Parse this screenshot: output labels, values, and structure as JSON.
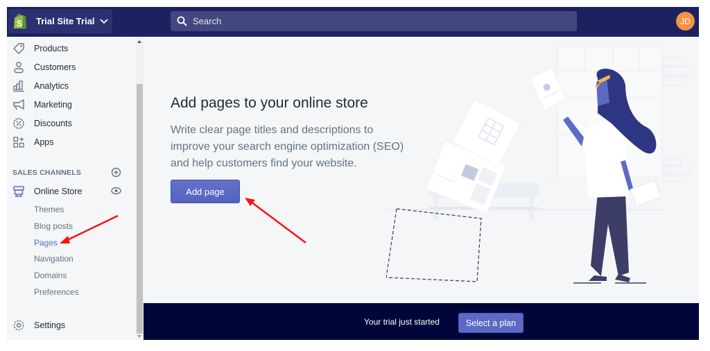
{
  "topbar": {
    "store_name": "Trial Site Trial",
    "search_placeholder": "Search",
    "avatar_initials": "JD",
    "colors": {
      "bar": "#1c2260",
      "search": "#43467f",
      "avatar": "#f49342",
      "logo": "#95bf47"
    }
  },
  "sidebar": {
    "items": [
      {
        "label": "Products",
        "icon": "tag-icon"
      },
      {
        "label": "Customers",
        "icon": "person-icon"
      },
      {
        "label": "Analytics",
        "icon": "bar-chart-icon"
      },
      {
        "label": "Marketing",
        "icon": "megaphone-icon"
      },
      {
        "label": "Discounts",
        "icon": "discount-icon"
      },
      {
        "label": "Apps",
        "icon": "apps-icon"
      }
    ],
    "sales_channels_label": "SALES CHANNELS",
    "online_store": {
      "label": "Online Store",
      "icon": "store-icon",
      "subitems": [
        "Themes",
        "Blog posts",
        "Pages",
        "Navigation",
        "Domains",
        "Preferences"
      ],
      "active_subitem": "Pages"
    },
    "settings_label": "Settings"
  },
  "main": {
    "heading": "Add pages to your online store",
    "description": "Write clear page titles and descriptions to improve your search engine optimization (SEO) and help customers find your website.",
    "add_page_label": "Add page",
    "accent": "#5c6ac4"
  },
  "trial": {
    "text": "Your trial just started",
    "select_plan_label": "Select a plan",
    "bg": "#000639"
  },
  "annotations": {
    "arrow_color": "#ff0000",
    "arrows": [
      "pointing-to-pages-nav",
      "pointing-to-add-page-button"
    ]
  }
}
